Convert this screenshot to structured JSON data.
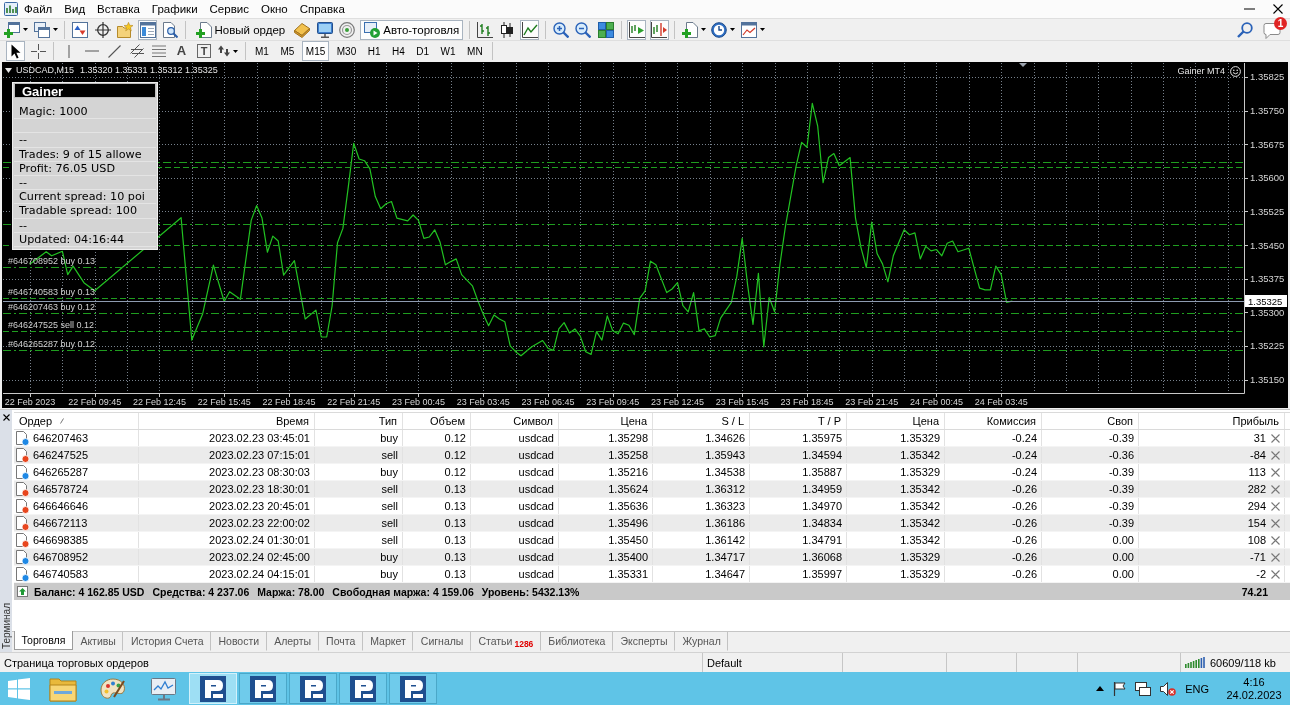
{
  "menu": {
    "items": [
      "Файл",
      "Вид",
      "Вставка",
      "Графики",
      "Сервис",
      "Окно",
      "Справка"
    ]
  },
  "main_toolbar": [
    {
      "kind": "icon",
      "pressed": false
    },
    {
      "kind": "icon",
      "pressed": false
    },
    {
      "kind": "icon",
      "pressed": false
    },
    {
      "kind": "icon",
      "pressed": false
    },
    {
      "kind": "icon",
      "pressed": false
    },
    {
      "kind": "icon",
      "pressed": true
    },
    {
      "kind": "icon",
      "pressed": false
    },
    {
      "kind": "labeled",
      "label": "Новый ордер",
      "pressed": false
    },
    {
      "kind": "icon",
      "pressed": false
    },
    {
      "kind": "icon",
      "pressed": false
    },
    {
      "kind": "icon",
      "pressed": false
    },
    {
      "kind": "labeled",
      "label": "Авто-торговля",
      "pressed": true
    },
    {
      "kind": "icon",
      "pressed": false
    },
    {
      "kind": "icon",
      "pressed": false
    },
    {
      "kind": "icon",
      "pressed": true
    },
    {
      "kind": "icon",
      "pressed": false
    },
    {
      "kind": "icon",
      "pressed": false
    },
    {
      "kind": "icon",
      "pressed": false
    },
    {
      "kind": "icon",
      "pressed": true
    },
    {
      "kind": "icon",
      "pressed": true
    },
    {
      "kind": "icon",
      "pressed": false
    },
    {
      "kind": "icon",
      "pressed": false
    },
    {
      "kind": "icon",
      "pressed": false
    }
  ],
  "notifications": {
    "count": "1"
  },
  "drawing_toolbar": [
    {
      "kind": "icon",
      "pressed": true
    },
    {
      "kind": "icon",
      "pressed": false
    },
    {
      "kind": "icon",
      "pressed": false
    },
    {
      "kind": "icon",
      "pressed": false
    },
    {
      "kind": "icon",
      "pressed": false
    },
    {
      "kind": "icon",
      "pressed": false
    },
    {
      "kind": "icon",
      "pressed": false
    },
    {
      "kind": "glyph",
      "glyph": "A",
      "pressed": false
    },
    {
      "kind": "boxed_glyph",
      "glyph": "T",
      "pressed": false
    },
    {
      "kind": "icon",
      "pressed": false
    }
  ],
  "timeframes": [
    {
      "label": "M1",
      "selected": false
    },
    {
      "label": "M5",
      "selected": false
    },
    {
      "label": "M15",
      "selected": true
    },
    {
      "label": "M30",
      "selected": false
    },
    {
      "label": "H1",
      "selected": false
    },
    {
      "label": "H4",
      "selected": false
    },
    {
      "label": "D1",
      "selected": false
    },
    {
      "label": "W1",
      "selected": false
    },
    {
      "label": "MN",
      "selected": false
    }
  ],
  "chart": {
    "symbol": "USDCAD,M15",
    "quotes": "1.35320 1.35331 1.35312 1.35325",
    "expert": "Gainer MT4",
    "info_panel": {
      "title": "Gainer",
      "rows": [
        {
          "kind": "text",
          "text": "Magic: 1000"
        },
        {
          "kind": "blank"
        },
        {
          "kind": "text",
          "text": "--"
        },
        {
          "kind": "text",
          "text": "Trades: 9 of 15 allowe"
        },
        {
          "kind": "text",
          "text": "Profit: 76.05 USD"
        },
        {
          "kind": "text",
          "text": "--"
        },
        {
          "kind": "text",
          "text": "Current spread: 10 poi"
        },
        {
          "kind": "text",
          "text": "Tradable spread: 100"
        },
        {
          "kind": "text",
          "text": "--"
        },
        {
          "kind": "text",
          "text": "Updated: 04:16:44"
        }
      ]
    },
    "chart_data": [
      {
        "type": "line",
        "color": "#22c322",
        "grid": true,
        "xlim": [
          "2023-02-22T05:30",
          "2023-02-24T15:00"
        ],
        "ylim": [
          1.3512,
          1.35856
        ],
        "xticks": [
          {
            "value": "2023-02-22T06:45",
            "label": "22 Feb 2023"
          },
          {
            "value": "2023-02-22T09:45",
            "label": "22 Feb 09:45"
          },
          {
            "value": "2023-02-22T12:45",
            "label": "22 Feb 12:45"
          },
          {
            "value": "2023-02-22T15:45",
            "label": "22 Feb 15:45"
          },
          {
            "value": "2023-02-22T18:45",
            "label": "22 Feb 18:45"
          },
          {
            "value": "2023-02-22T21:45",
            "label": "22 Feb 21:45"
          },
          {
            "value": "2023-02-23T00:45",
            "label": "23 Feb 00:45"
          },
          {
            "value": "2023-02-23T03:45",
            "label": "23 Feb 03:45"
          },
          {
            "value": "2023-02-23T06:45",
            "label": "23 Feb 06:45"
          },
          {
            "value": "2023-02-23T09:45",
            "label": "23 Feb 09:45"
          },
          {
            "value": "2023-02-23T12:45",
            "label": "23 Feb 12:45"
          },
          {
            "value": "2023-02-23T15:45",
            "label": "23 Feb 15:45"
          },
          {
            "value": "2023-02-23T18:45",
            "label": "23 Feb 18:45"
          },
          {
            "value": "2023-02-23T21:45",
            "label": "23 Feb 21:45"
          },
          {
            "value": "2023-02-24T00:45",
            "label": "24 Feb 00:45"
          },
          {
            "value": "2023-02-24T03:45",
            "label": "24 Feb 03:45"
          }
        ],
        "yticks": [
          {
            "value": 1.3515,
            "label": "1.35150"
          },
          {
            "value": 1.35225,
            "label": "1.35225"
          },
          {
            "value": 1.353,
            "label": "1.35300"
          },
          {
            "value": 1.35375,
            "label": "1.35375"
          },
          {
            "value": 1.3545,
            "label": "1.35450"
          },
          {
            "value": 1.35525,
            "label": "1.35525"
          },
          {
            "value": 1.356,
            "label": "1.35600"
          },
          {
            "value": 1.35675,
            "label": "1.35675"
          },
          {
            "value": 1.3575,
            "label": "1.35750"
          },
          {
            "value": 1.35825,
            "label": "1.35825"
          }
        ],
        "x": [
          "2023-02-22T06:45",
          "2023-02-22T07:30",
          "2023-02-22T07:45",
          "2023-02-22T08:15",
          "2023-02-22T08:30",
          "2023-02-22T08:45",
          "2023-02-22T09:15",
          "2023-02-22T09:45",
          "2023-02-22T13:45",
          "2023-02-22T14:15",
          "2023-02-22T14:45",
          "2023-02-22T15:15",
          "2023-02-22T15:45",
          "2023-02-22T16:00",
          "2023-02-22T16:30",
          "2023-02-22T17:00",
          "2023-02-22T17:15",
          "2023-02-22T17:30",
          "2023-02-22T17:45",
          "2023-02-22T18:00",
          "2023-02-22T18:15",
          "2023-02-22T18:30",
          "2023-02-22T19:00",
          "2023-02-22T19:30",
          "2023-02-22T20:00",
          "2023-02-22T20:15",
          "2023-02-22T20:30",
          "2023-02-22T20:45",
          "2023-02-22T21:00",
          "2023-02-22T21:15",
          "2023-02-22T21:30",
          "2023-02-22T21:45",
          "2023-02-22T22:00",
          "2023-02-22T22:15",
          "2023-02-22T22:30",
          "2023-02-22T22:45",
          "2023-02-22T23:00",
          "2023-02-22T23:15",
          "2023-02-22T23:30",
          "2023-02-22T23:45",
          "2023-02-23T00:15",
          "2023-02-23T00:30",
          "2023-02-23T00:45",
          "2023-02-23T01:00",
          "2023-02-23T01:15",
          "2023-02-23T01:30",
          "2023-02-23T01:45",
          "2023-02-23T02:00",
          "2023-02-23T02:15",
          "2023-02-23T02:30",
          "2023-02-23T02:45",
          "2023-02-23T03:15",
          "2023-02-23T03:30",
          "2023-02-23T03:45",
          "2023-02-23T04:00",
          "2023-02-23T04:15",
          "2023-02-23T04:30",
          "2023-02-23T04:45",
          "2023-02-23T05:00",
          "2023-02-23T05:15",
          "2023-02-23T05:30",
          "2023-02-23T06:00",
          "2023-02-23T06:30",
          "2023-02-23T06:45",
          "2023-02-23T07:00",
          "2023-02-23T07:15",
          "2023-02-23T07:30",
          "2023-02-23T07:45",
          "2023-02-23T08:00",
          "2023-02-23T08:15",
          "2023-02-23T08:30",
          "2023-02-23T08:45",
          "2023-02-23T09:00",
          "2023-02-23T09:15",
          "2023-02-23T09:30",
          "2023-02-23T09:45",
          "2023-02-23T10:00",
          "2023-02-23T10:15",
          "2023-02-23T10:30",
          "2023-02-23T10:45",
          "2023-02-23T11:00",
          "2023-02-23T11:15",
          "2023-02-23T11:30",
          "2023-02-23T11:45",
          "2023-02-23T12:15",
          "2023-02-23T12:30",
          "2023-02-23T12:45",
          "2023-02-23T13:00",
          "2023-02-23T13:15",
          "2023-02-23T13:30",
          "2023-02-23T13:45",
          "2023-02-23T14:00",
          "2023-02-23T14:15",
          "2023-02-23T14:30",
          "2023-02-23T14:45",
          "2023-02-23T15:00",
          "2023-02-23T15:15",
          "2023-02-23T15:30",
          "2023-02-23T15:45",
          "2023-02-23T16:00",
          "2023-02-23T16:15",
          "2023-02-23T16:30",
          "2023-02-23T16:45",
          "2023-02-23T17:00",
          "2023-02-23T17:15",
          "2023-02-23T17:30",
          "2023-02-23T17:45",
          "2023-02-23T18:15",
          "2023-02-23T18:30",
          "2023-02-23T18:45",
          "2023-02-23T19:00",
          "2023-02-23T19:15",
          "2023-02-23T19:30",
          "2023-02-23T19:45",
          "2023-02-23T20:00",
          "2023-02-23T20:15",
          "2023-02-23T20:45",
          "2023-02-23T21:00",
          "2023-02-23T21:15",
          "2023-02-23T21:30",
          "2023-02-23T21:45",
          "2023-02-23T22:00",
          "2023-02-23T22:15",
          "2023-02-23T22:30",
          "2023-02-23T22:45",
          "2023-02-23T23:15",
          "2023-02-23T23:30",
          "2023-02-23T23:45",
          "2023-02-24T00:00",
          "2023-02-24T00:15",
          "2023-02-24T00:30",
          "2023-02-24T00:45",
          "2023-02-24T01:00",
          "2023-02-24T01:15",
          "2023-02-24T01:30",
          "2023-02-24T01:45",
          "2023-02-24T02:15",
          "2023-02-24T02:30",
          "2023-02-24T02:45",
          "2023-02-24T03:00",
          "2023-02-24T03:15",
          "2023-02-24T03:30",
          "2023-02-24T03:45",
          "2023-02-24T04:00",
          "2023-02-24T04:15"
        ],
        "values": [
          1.35408,
          1.35435,
          1.35426,
          1.35436,
          1.35384,
          1.35403,
          1.35366,
          1.35348,
          1.35511,
          1.35238,
          1.35296,
          1.35405,
          1.35324,
          1.35346,
          1.35329,
          1.35505,
          1.35538,
          1.3551,
          1.35434,
          1.3547,
          1.35459,
          1.35383,
          1.35415,
          1.35285,
          1.35305,
          1.35245,
          1.35245,
          1.35314,
          1.35455,
          1.35487,
          1.3558,
          1.35677,
          1.35642,
          1.35638,
          1.3562,
          1.35558,
          1.35531,
          1.35542,
          1.35547,
          1.3551,
          1.35504,
          1.35517,
          1.35505,
          1.35465,
          1.35468,
          1.35484,
          1.35457,
          1.35406,
          1.35413,
          1.35419,
          1.35384,
          1.35359,
          1.35326,
          1.35296,
          1.3527,
          1.35294,
          1.35285,
          1.35279,
          1.35225,
          1.35212,
          1.35203,
          1.35223,
          1.35237,
          1.3522,
          1.35215,
          1.35263,
          1.35277,
          1.35254,
          1.35263,
          1.35247,
          1.35212,
          1.35206,
          1.35257,
          1.35238,
          1.35292,
          1.35259,
          1.35252,
          1.35276,
          1.35271,
          1.3525,
          1.35331,
          1.35348,
          1.35414,
          1.35406,
          1.35344,
          1.35352,
          1.35366,
          1.35315,
          1.35301,
          1.35344,
          1.35259,
          1.35263,
          1.35245,
          1.35248,
          1.35287,
          1.35305,
          1.35322,
          1.3538,
          1.35465,
          1.35361,
          1.35273,
          1.35387,
          1.35223,
          1.35333,
          1.35301,
          1.35408,
          1.35491,
          1.35627,
          1.35679,
          1.35668,
          1.35766,
          1.35715,
          1.35589,
          1.35645,
          1.35654,
          1.35627,
          1.35645,
          1.3551,
          1.35445,
          1.354,
          1.35501,
          1.35431,
          1.35408,
          1.35368,
          1.35426,
          1.35484,
          1.35473,
          1.35477,
          1.35419,
          1.35447,
          1.35437,
          1.3544,
          1.35426,
          1.35454,
          1.35459,
          1.35435,
          1.35443,
          1.35398,
          1.35354,
          1.3535,
          1.3535,
          1.35403,
          1.35384,
          1.35322,
          1.35325
        ],
        "ref_lines": [
          {
            "axis": "y",
            "value": 1.35636,
            "color": "#1f9d1f",
            "line_style": "dashdot"
          },
          {
            "axis": "y",
            "value": 1.35624,
            "color": "#1f9d1f",
            "line_style": "dashed"
          },
          {
            "axis": "y",
            "value": 1.35496,
            "color": "#1f9d1f",
            "line_style": "dashdot"
          },
          {
            "axis": "y",
            "value": 1.3545,
            "color": "#1f9d1f",
            "line_style": "dashed"
          },
          {
            "axis": "y",
            "value": 1.354,
            "label": "#646708952 buy 0.13",
            "color": "#1f9d1f",
            "line_style": "dashdot"
          },
          {
            "axis": "y",
            "value": 1.35331,
            "label": "#646740583 buy 0.13",
            "color": "#1f9d1f",
            "line_style": "dashed"
          },
          {
            "axis": "y",
            "value": 1.35298,
            "label": "#646207463 buy 0.12",
            "color": "#1f9d1f",
            "line_style": "dashdot"
          },
          {
            "axis": "y",
            "value": 1.35258,
            "label": "#646247525 sell 0.12",
            "color": "#1f9d1f",
            "line_style": "dashed"
          },
          {
            "axis": "y",
            "value": 1.35216,
            "label": "#646265287 buy 0.12",
            "color": "#1f9d1f",
            "line_style": "dashdot"
          },
          {
            "axis": "y",
            "value": 1.35325,
            "label": "1.35325",
            "color": "#8e9bb0",
            "line_style": "solid"
          }
        ]
      }
    ]
  },
  "terminal": {
    "title": "Терминал",
    "columns": [
      {
        "label": "Ордер",
        "sorted": true
      },
      {
        "label": "Время",
        "sorted": false
      },
      {
        "label": "Тип",
        "sorted": false
      },
      {
        "label": "Объем",
        "sorted": false
      },
      {
        "label": "Символ",
        "sorted": false
      },
      {
        "label": "Цена",
        "sorted": false
      },
      {
        "label": "S / L",
        "sorted": false
      },
      {
        "label": "T / P",
        "sorted": false
      },
      {
        "label": "Цена",
        "sorted": false
      },
      {
        "label": "Комиссия",
        "sorted": false
      },
      {
        "label": "Своп",
        "sorted": false
      },
      {
        "label": "Прибыль",
        "sorted": false
      }
    ],
    "rows": [
      {
        "kind": "buy",
        "cells": [
          "646207463",
          "2023.02.23 03:45:01",
          "buy",
          "0.12",
          "usdcad",
          "1.35298",
          "1.34626",
          "1.35975",
          "1.35329",
          "-0.24",
          "-0.39",
          "31"
        ]
      },
      {
        "kind": "sell",
        "cells": [
          "646247525",
          "2023.02.23 07:15:01",
          "sell",
          "0.12",
          "usdcad",
          "1.35258",
          "1.35943",
          "1.34594",
          "1.35342",
          "-0.24",
          "-0.36",
          "-84"
        ]
      },
      {
        "kind": "buy",
        "cells": [
          "646265287",
          "2023.02.23 08:30:03",
          "buy",
          "0.12",
          "usdcad",
          "1.35216",
          "1.34538",
          "1.35887",
          "1.35329",
          "-0.24",
          "-0.39",
          "113"
        ]
      },
      {
        "kind": "sell",
        "cells": [
          "646578724",
          "2023.02.23 18:30:01",
          "sell",
          "0.13",
          "usdcad",
          "1.35624",
          "1.36312",
          "1.34959",
          "1.35342",
          "-0.26",
          "-0.39",
          "282"
        ]
      },
      {
        "kind": "sell",
        "cells": [
          "646646646",
          "2023.02.23 20:45:01",
          "sell",
          "0.13",
          "usdcad",
          "1.35636",
          "1.36323",
          "1.34970",
          "1.35342",
          "-0.26",
          "-0.39",
          "294"
        ]
      },
      {
        "kind": "sell",
        "cells": [
          "646672113",
          "2023.02.23 22:00:02",
          "sell",
          "0.13",
          "usdcad",
          "1.35496",
          "1.36186",
          "1.34834",
          "1.35342",
          "-0.26",
          "-0.39",
          "154"
        ]
      },
      {
        "kind": "sell",
        "cells": [
          "646698385",
          "2023.02.24 01:30:01",
          "sell",
          "0.13",
          "usdcad",
          "1.35450",
          "1.36142",
          "1.34791",
          "1.35342",
          "-0.26",
          "0.00",
          "108"
        ]
      },
      {
        "kind": "buy",
        "cells": [
          "646708952",
          "2023.02.24 02:45:00",
          "buy",
          "0.13",
          "usdcad",
          "1.35400",
          "1.34717",
          "1.36068",
          "1.35329",
          "-0.26",
          "0.00",
          "-71"
        ]
      },
      {
        "kind": "buy",
        "cells": [
          "646740583",
          "2023.02.24 04:15:01",
          "buy",
          "0.13",
          "usdcad",
          "1.35331",
          "1.34647",
          "1.35997",
          "1.35329",
          "-0.26",
          "0.00",
          "-2"
        ]
      }
    ],
    "summary": {
      "items": [
        "Баланс: 4 162.85 USD",
        "Средства: 4 237.06",
        "Маржа: 78.00",
        "Свободная маржа: 4 159.06",
        "Уровень: 5432.13%"
      ],
      "profit": "74.21"
    },
    "tabs": [
      {
        "label": "Торговля",
        "selected": true
      },
      {
        "label": "Активы",
        "selected": false
      },
      {
        "label": "История Счета",
        "selected": false
      },
      {
        "label": "Новости",
        "selected": false
      },
      {
        "label": "Алерты",
        "selected": false
      },
      {
        "label": "Почта",
        "selected": false
      },
      {
        "label": "Маркет",
        "selected": false
      },
      {
        "label": "Сигналы",
        "selected": false
      },
      {
        "label": "Статьи",
        "selected": false,
        "badge": "1286"
      },
      {
        "label": "Библиотека",
        "selected": false
      },
      {
        "label": "Эксперты",
        "selected": false
      },
      {
        "label": "Журнал",
        "selected": false
      }
    ]
  },
  "status_bar": {
    "message": "Страница торговых ордеров",
    "profile": "Default",
    "traffic": "60609/118 kb"
  },
  "taskbar": {
    "language": "ENG",
    "time": "4:16",
    "date": "24.02.2023"
  }
}
